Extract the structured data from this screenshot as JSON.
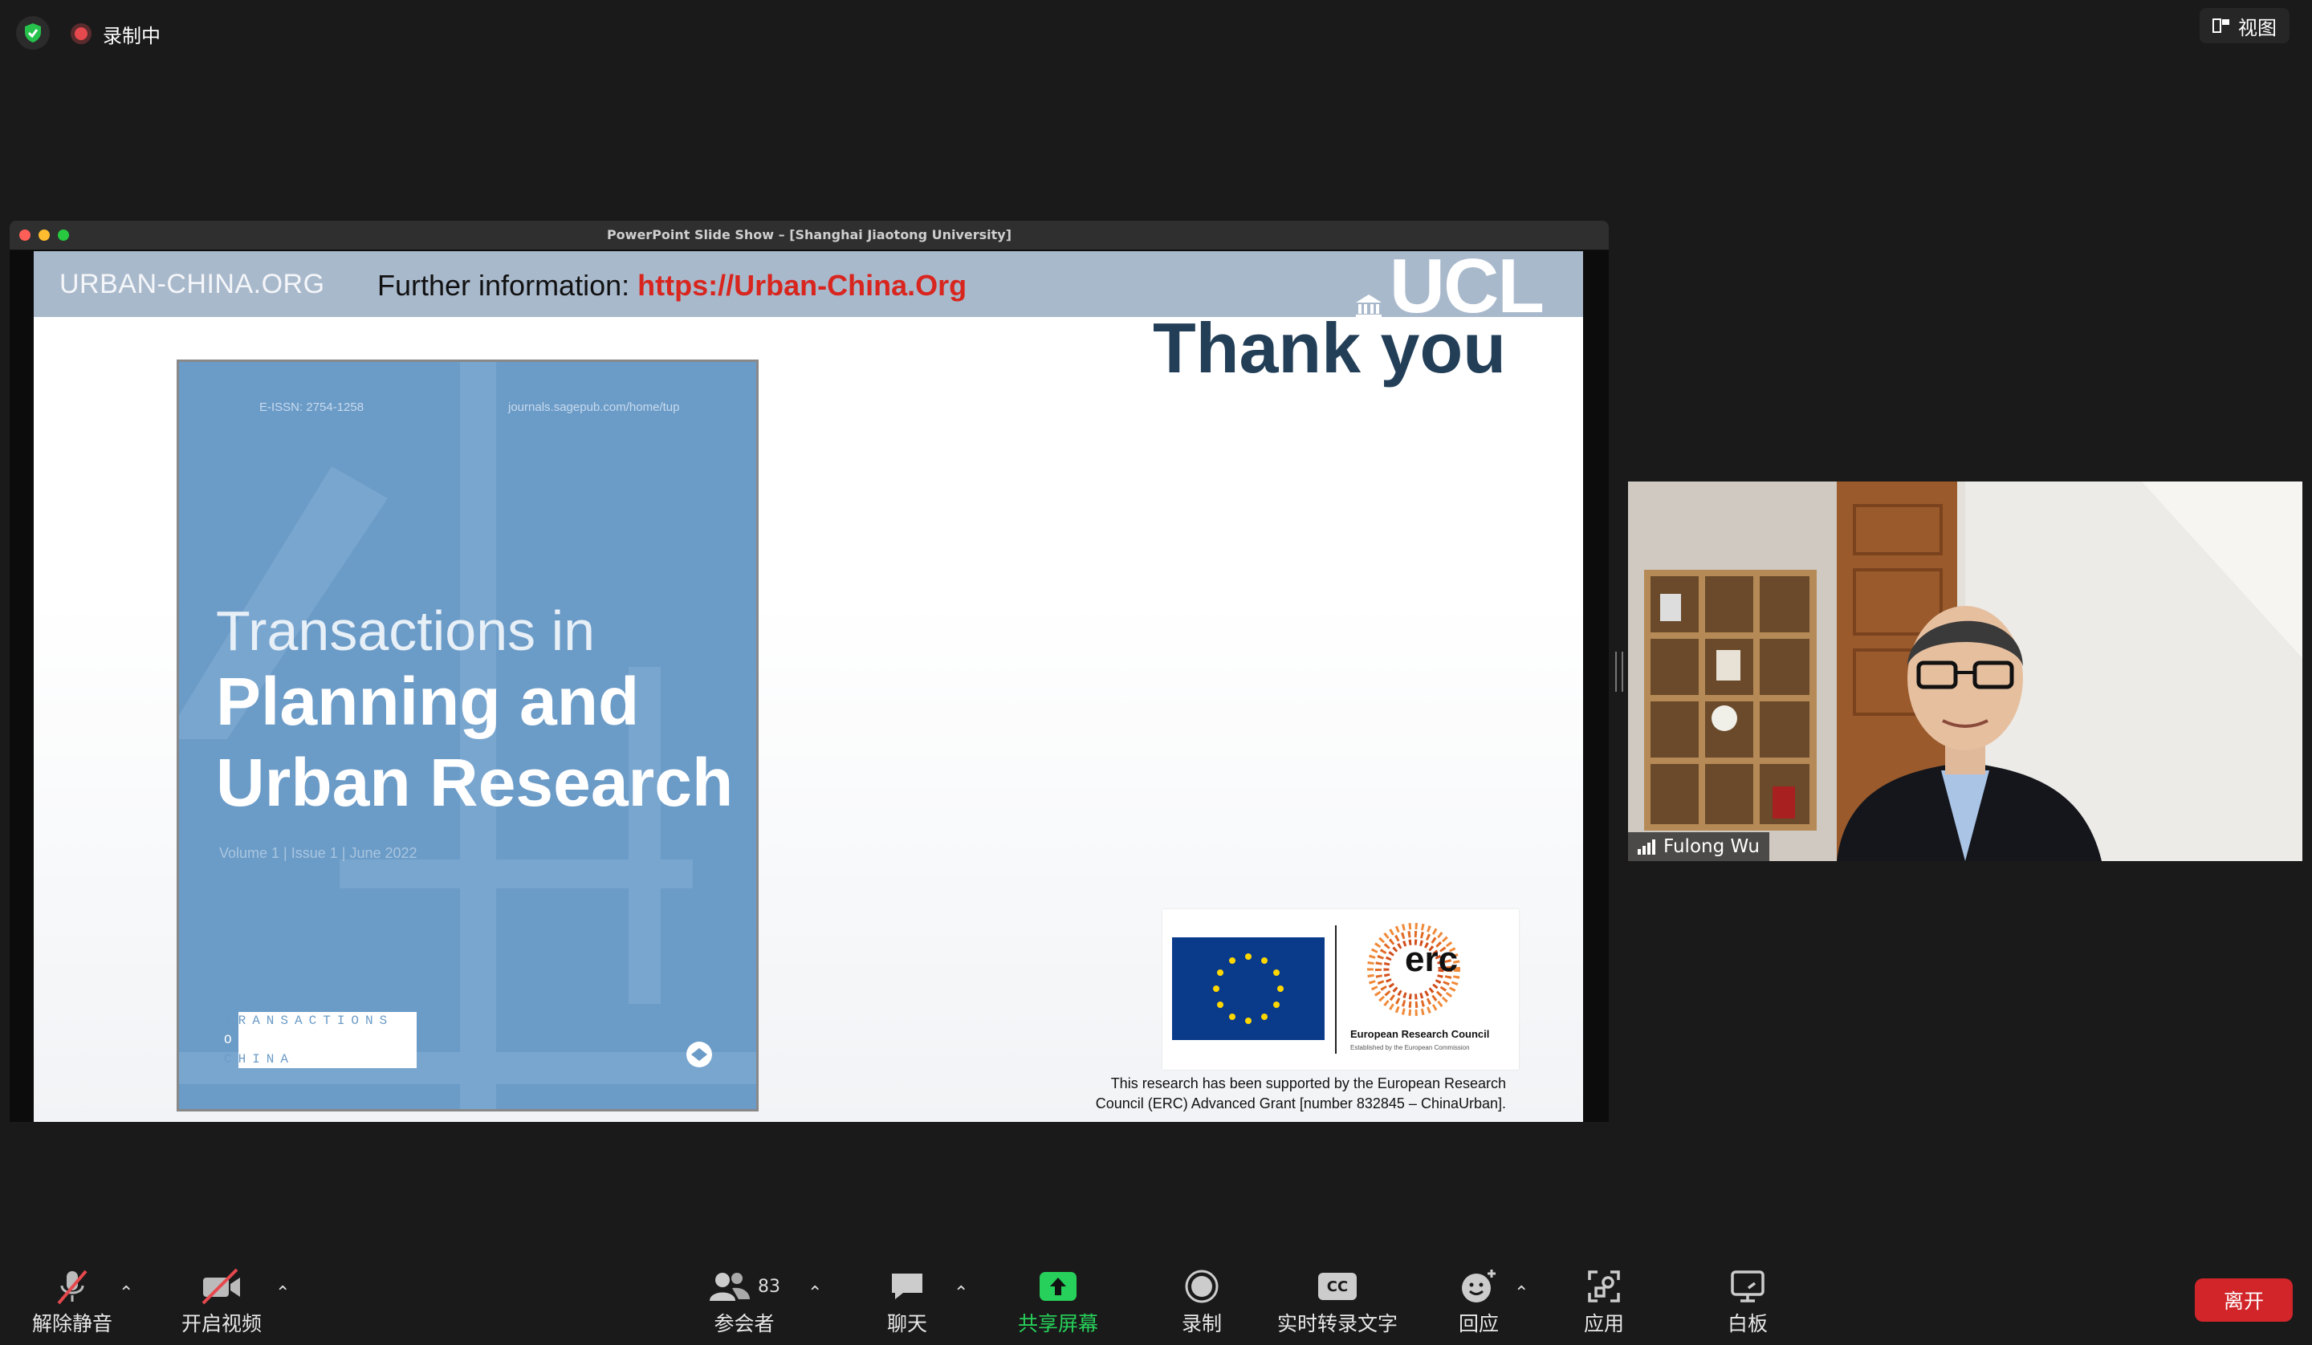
{
  "status": {
    "recording_label": "录制中",
    "view_label": "视图"
  },
  "window": {
    "title": "PowerPoint Slide Show – [Shanghai Jiaotong University]"
  },
  "slide": {
    "header_left": "URBAN-CHINA.ORG",
    "header_info_prefix": "Further information: ",
    "header_info_url": "https://Urban-China.Org",
    "ucl_logo": "UCL",
    "thank_you": "Thank you",
    "journal": {
      "issn": "E-ISSN: 2754-1258",
      "site": "journals.sagepub.com/home/tup",
      "title_line1": "Transactions in",
      "title_line2": "Planning and",
      "title_line3": "Urban Research",
      "volume": "Volume 1 | Issue 1 | June 2022",
      "toc_1": "TRANSACTIONS",
      "toc_2": "ON",
      "toc_3": "CHINA"
    },
    "erc_logo_text": "erc",
    "erc_name": "European Research Council",
    "erc_sub": "Established by the European Commission",
    "footnote_line1": "This research has been supported by the European Research",
    "footnote_line2": "Council (ERC) Advanced Grant [number 832845 – ChinaUrban]."
  },
  "video": {
    "participant_name": "Fulong Wu"
  },
  "toolbar": {
    "unmute": "解除静音",
    "start_video": "开启视频",
    "participants": "参会者",
    "participants_count": "83",
    "chat": "聊天",
    "share_screen": "共享屏幕",
    "record": "录制",
    "live_transcript": "实时转录文字",
    "reactions": "回应",
    "apps": "应用",
    "whiteboard": "白板",
    "leave": "离开",
    "cc_glyph": "CC"
  },
  "colors": {
    "share_green": "#27d05a",
    "leave_red": "#d1252a",
    "slide_header": "#a9b9cc",
    "journal_blue": "#6b9bc7",
    "thank_you": "#233f58",
    "url_red": "#d8261f"
  },
  "icons": [
    "shield-icon",
    "recording-icon",
    "view-icon",
    "mic-muted-icon",
    "video-off-icon",
    "participants-icon",
    "chat-icon",
    "share-screen-icon",
    "record-icon",
    "cc-icon",
    "reactions-icon",
    "apps-icon",
    "whiteboard-icon",
    "signal-icon"
  ]
}
